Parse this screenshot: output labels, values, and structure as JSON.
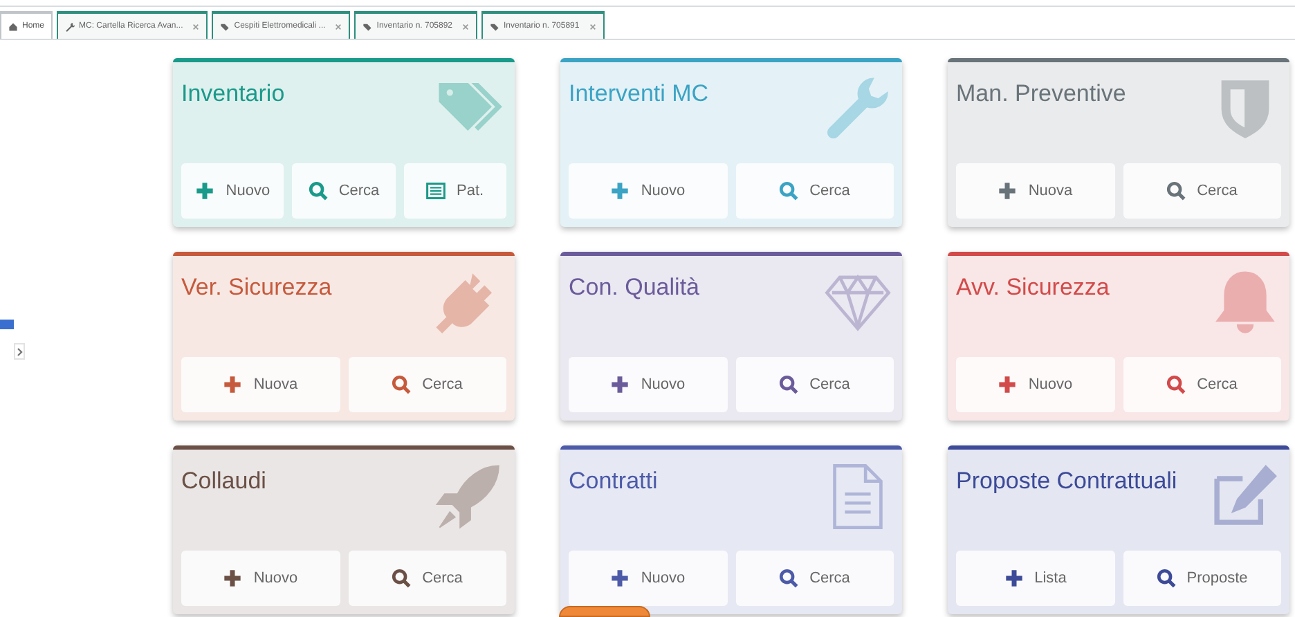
{
  "tabs": [
    {
      "label": "Home",
      "kind": "home",
      "selected": true
    },
    {
      "label": "MC: Cartella Ricerca Avan...",
      "kind": "wrench",
      "selected": false
    },
    {
      "label": "Cespiti Elettromedicali ...",
      "kind": "tag",
      "selected": false
    },
    {
      "label": "Inventario n. 705892",
      "kind": "tag",
      "selected": false
    },
    {
      "label": "Inventario n. 705891",
      "kind": "tag",
      "selected": false
    }
  ],
  "cards": [
    {
      "title": "Inventario",
      "kind": "tag",
      "color": "#1a9a8a",
      "buttons": [
        {
          "kind": "plus",
          "label": "Nuovo"
        },
        {
          "kind": "search",
          "label": "Cerca"
        },
        {
          "kind": "list",
          "label": "Pat."
        }
      ]
    },
    {
      "title": "Interventi MC",
      "kind": "wrench",
      "color": "#3ba3c4",
      "buttons": [
        {
          "kind": "plus",
          "label": "Nuovo"
        },
        {
          "kind": "search",
          "label": "Cerca"
        }
      ]
    },
    {
      "title": "Man. Preventive",
      "kind": "shield",
      "color": "#69737a",
      "buttons": [
        {
          "kind": "plus",
          "label": "Nuova"
        },
        {
          "kind": "search",
          "label": "Cerca"
        }
      ]
    },
    {
      "title": "Ver. Sicurezza",
      "kind": "plug",
      "color": "#c65a3c",
      "buttons": [
        {
          "kind": "plus",
          "label": "Nuova"
        },
        {
          "kind": "search",
          "label": "Cerca"
        }
      ]
    },
    {
      "title": "Con. Qualità",
      "kind": "diamond",
      "color": "#6b5b9b",
      "buttons": [
        {
          "kind": "plus",
          "label": "Nuovo"
        },
        {
          "kind": "search",
          "label": "Cerca"
        }
      ]
    },
    {
      "title": "Avv. Sicurezza",
      "kind": "bell",
      "color": "#d24a4a",
      "buttons": [
        {
          "kind": "plus",
          "label": "Nuovo"
        },
        {
          "kind": "search",
          "label": "Cerca"
        }
      ]
    },
    {
      "title": "Collaudi",
      "kind": "rocket",
      "color": "#6b5046",
      "buttons": [
        {
          "kind": "plus",
          "label": "Nuovo"
        },
        {
          "kind": "search",
          "label": "Cerca"
        }
      ]
    },
    {
      "title": "Contratti",
      "kind": "document",
      "color": "#4c5aa8",
      "buttons": [
        {
          "kind": "plus",
          "label": "Nuovo"
        },
        {
          "kind": "search",
          "label": "Cerca"
        }
      ]
    },
    {
      "title": "Proposte Contrattuali",
      "kind": "pencil",
      "color": "#3c4a98",
      "buttons": [
        {
          "kind": "plus",
          "label": "Lista"
        },
        {
          "kind": "search",
          "label": "Proposte"
        }
      ]
    }
  ]
}
